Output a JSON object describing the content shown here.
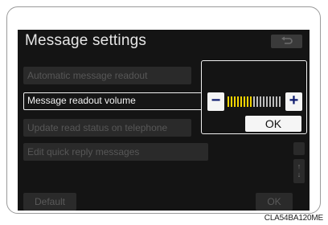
{
  "screen": {
    "title": "Message settings",
    "menu_items": [
      {
        "label": "Automatic message readout",
        "active": false
      },
      {
        "label": "Message readout volume",
        "active": true
      },
      {
        "label": "Update read status on telephone",
        "active": false
      },
      {
        "label": "Edit quick reply messages",
        "active": false
      }
    ],
    "default_label": "Default",
    "ok_label": "OK",
    "back_icon": "back-arrow-icon",
    "scroll_icons": [
      "scroll-up-icon",
      "scroll-down-icon"
    ]
  },
  "popup": {
    "minus_label": "−",
    "plus_label": "+",
    "ok_label": "OK",
    "volume_level": 0.45,
    "bar_count": 17
  },
  "colors": {
    "screen_bg": "#141414",
    "bar_active": "#f2d400",
    "bar_inactive": "#bdbdbd",
    "button_text": "#0d1a6e"
  },
  "figure_code": "CLA54BA120ME"
}
